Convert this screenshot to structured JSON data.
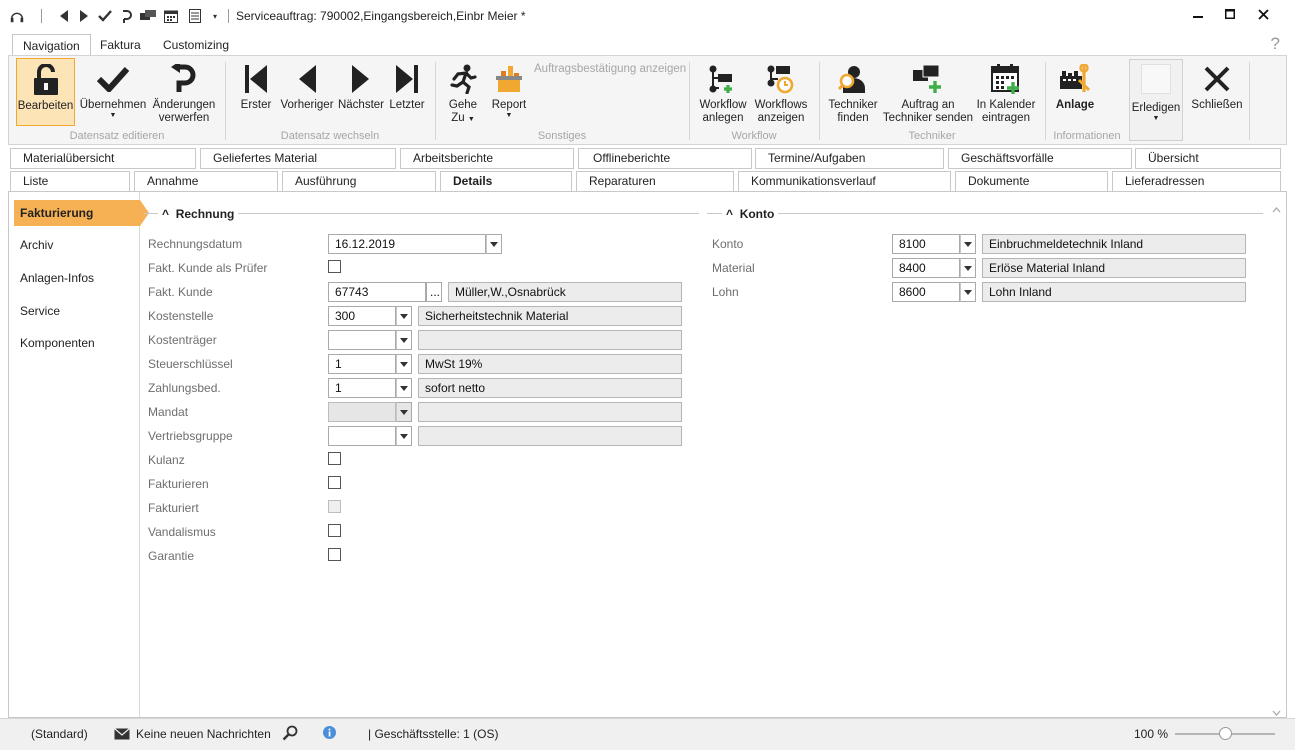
{
  "window": {
    "title": "Serviceauftrag: 790002,Eingangsbereich,Einbr Meier *"
  },
  "ribbon_tabs": [
    {
      "label": "Navigation",
      "active": true
    },
    {
      "label": "Faktura",
      "active": false
    },
    {
      "label": "Customizing",
      "active": false
    }
  ],
  "help": "?",
  "ribbon": {
    "bearbeiten": "Bearbeiten",
    "uebernehmen": "Übernehmen",
    "aenderungen_1": "Änderungen",
    "aenderungen_2": "verwerfen",
    "grp_datensatz_editieren": "Datensatz editieren",
    "erster": "Erster",
    "vorheriger": "Vorheriger",
    "naechster": "Nächster",
    "letzter": "Letzter",
    "grp_datensatz_wechseln": "Datensatz wechseln",
    "gehe_1": "Gehe",
    "gehe_2": "Zu",
    "report": "Report",
    "auftragsbestaetigung": "Auftragsbestätigung anzeigen",
    "grp_sonstiges": "Sonstiges",
    "wf_anlegen_1": "Workflow",
    "wf_anlegen_2": "anlegen",
    "wf_anzeigen_1": "Workflows",
    "wf_anzeigen_2": "anzeigen",
    "grp_workflow": "Workflow",
    "techniker_finden_1": "Techniker",
    "techniker_finden_2": "finden",
    "auftrag_senden_1": "Auftrag an",
    "auftrag_senden_2": "Techniker senden",
    "kalender_1": "In Kalender",
    "kalender_2": "eintragen",
    "grp_techniker": "Techniker",
    "anlage": "Anlage",
    "grp_informationen": "Informationen",
    "erledigen": "Erledigen",
    "schliessen": "Schließen"
  },
  "tabs_row1": [
    "Materialübersicht",
    "Geliefertes Material",
    "Arbeitsberichte",
    "Offlineberichte",
    "Termine/Aufgaben",
    "Geschäftsvorfälle",
    "Übersicht"
  ],
  "tabs_row2": [
    "Liste",
    "Annahme",
    "Ausführung",
    "Details",
    "Reparaturen",
    "Kommunikationsverlauf",
    "Dokumente",
    "Lieferadressen"
  ],
  "tabs_row2_active": "Details",
  "sidebar": [
    "Fakturierung",
    "Archiv",
    "Anlagen-Infos",
    "Service",
    "Komponenten"
  ],
  "rechnung": {
    "title": "Rechnung",
    "rechnungsdatum_label": "Rechnungsdatum",
    "rechnungsdatum": "16.12.2019",
    "fakt_kunde_pruefer_label": "Fakt. Kunde als Prüfer",
    "fakt_kunde_label": "Fakt. Kunde",
    "fakt_kunde": "67743",
    "fakt_kunde_btn": "...",
    "fakt_kunde_name": "Müller,W.,Osnabrück",
    "kostenstelle_label": "Kostenstelle",
    "kostenstelle": "300",
    "kostenstelle_text": "Sicherheitstechnik Material",
    "kostentraeger_label": "Kostenträger",
    "kostentraeger": "",
    "kostentraeger_text": "",
    "steuerschluessel_label": "Steuerschlüssel",
    "steuerschluessel": "1",
    "steuerschluessel_text": "MwSt 19%",
    "zahlungsbed_label": "Zahlungsbed.",
    "zahlungsbed": "1",
    "zahlungsbed_text": "sofort netto",
    "mandat_label": "Mandat",
    "mandat": "",
    "mandat_text": "",
    "vertriebsgruppe_label": "Vertriebsgruppe",
    "vertriebsgruppe": "",
    "vertriebsgruppe_text": "",
    "kulanz_label": "Kulanz",
    "fakturieren_label": "Fakturieren",
    "fakturiert_label": "Fakturiert",
    "vandalismus_label": "Vandalismus",
    "garantie_label": "Garantie"
  },
  "konto": {
    "title": "Konto",
    "konto_label": "Konto",
    "konto": "8100",
    "konto_text": "Einbruchmeldetechnik Inland",
    "material_label": "Material",
    "material": "8400",
    "material_text": "Erlöse Material Inland",
    "lohn_label": "Lohn",
    "lohn": "8600",
    "lohn_text": "Lohn Inland"
  },
  "statusbar": {
    "standard": "(Standard)",
    "nachrichten": "Keine neuen Nachrichten",
    "geschaeftsstelle": "| Geschäftsstelle:  1 (OS)",
    "zoom": "100 %",
    "zoom_percent": 100
  },
  "colors": {
    "accent": "#f7b155",
    "selected_button_bg": "#fce4b7",
    "info_icon": "#4a90d9"
  }
}
